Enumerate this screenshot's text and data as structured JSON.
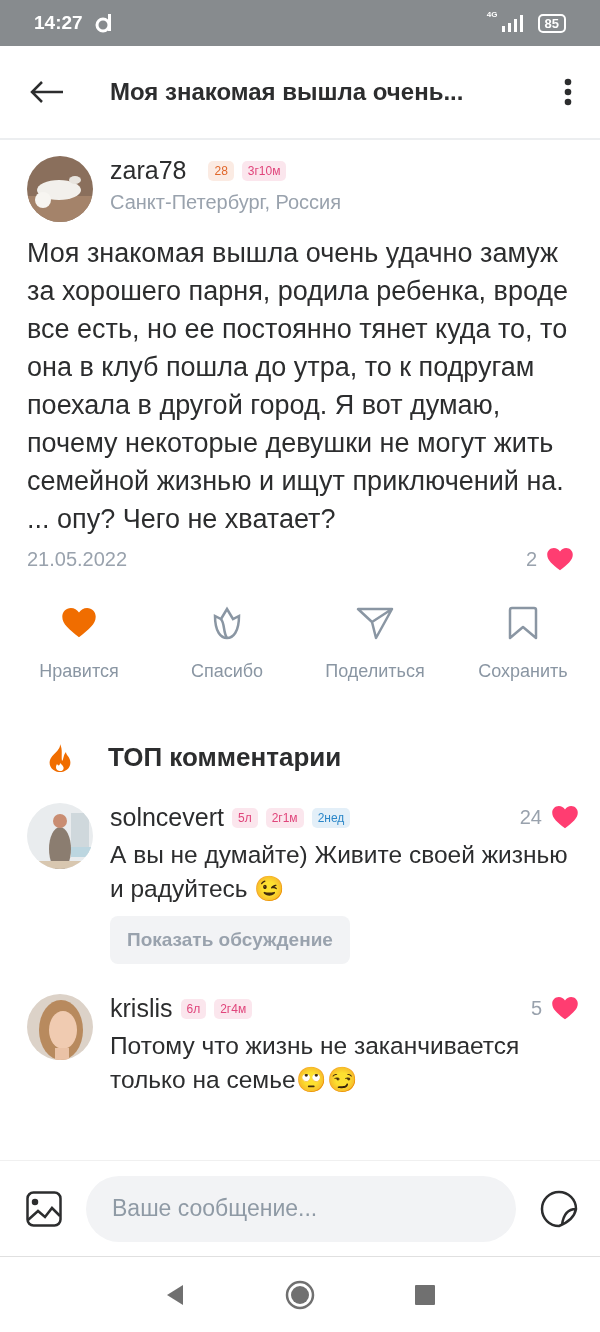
{
  "status_bar": {
    "time": "14:27",
    "network": "4G",
    "battery": "85"
  },
  "header": {
    "title": "Моя знакомая вышла очень..."
  },
  "post": {
    "author": "zara78",
    "badges": [
      {
        "text": "28",
        "color": "#e0672a"
      },
      {
        "text": "3г10м",
        "color": "#e0457b"
      }
    ],
    "location": "Санкт-Петербург, Россия",
    "text": "Моя знакомая вышла очень удачно замуж за хорошего парня, родила ребенка, вроде все есть, но ее постоянно тянет куда то, то она в клуб пошла до утра, то к подругам поехала в другой город. Я вот думаю, почему некоторые девушки не могут жить семейной жизнью и ищут приключений на. ... опу?  Чего не хватает?",
    "date": "21.05.2022",
    "likes": "2"
  },
  "actions": [
    {
      "kind": "like",
      "label": "Нравится",
      "on": true
    },
    {
      "kind": "thanks",
      "label": "Спасибо",
      "on": false
    },
    {
      "kind": "share",
      "label": "Поделиться",
      "on": false
    },
    {
      "kind": "save",
      "label": "Сохранить",
      "on": false
    }
  ],
  "comments_section": {
    "title": "ТОП комментарии"
  },
  "comments": [
    {
      "author": "solncevert",
      "badges": [
        {
          "text": "5л",
          "color": "#e0457b"
        },
        {
          "text": "2г1м",
          "color": "#e0457b"
        },
        {
          "text": "2нед",
          "color": "#2a86c8"
        }
      ],
      "likes": "24",
      "text": "А вы не думайте) Живите своей жизнью и радуйтесь 😉",
      "discussion_button": "Показать обсуждение"
    },
    {
      "author": "krislis",
      "badges": [
        {
          "text": "6л",
          "color": "#e0457b"
        },
        {
          "text": "2г4м",
          "color": "#e0457b"
        }
      ],
      "likes": "5",
      "text": "Потому что жизнь не заканчивается только на семье🙄😏"
    }
  ],
  "composer": {
    "placeholder": "Ваше сообщение..."
  }
}
